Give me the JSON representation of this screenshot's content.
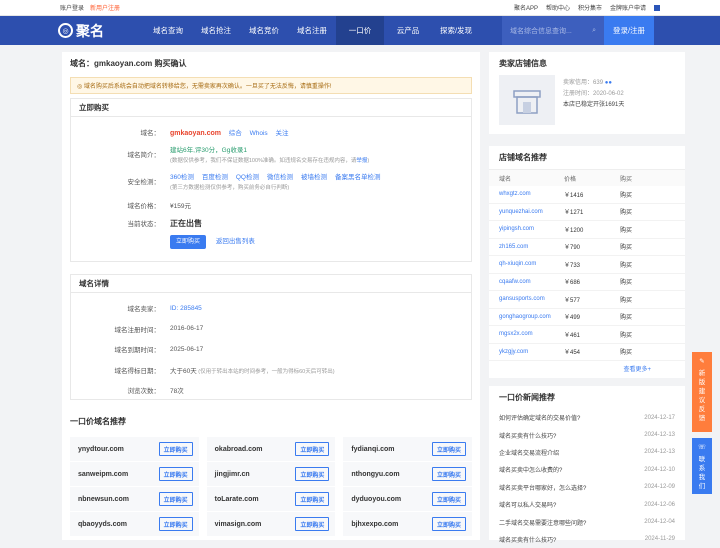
{
  "topbar": {
    "login": "账户登录",
    "register": "新用户注册",
    "app": "聚名APP",
    "help": "帮助中心",
    "points": "积分集市",
    "gold": "金牌账户申请"
  },
  "nav": {
    "logo": "聚名",
    "items": [
      "域名查询",
      "域名抢注",
      "域名竞价",
      "域名注册",
      "一口价",
      "云产品",
      "探索/发现"
    ],
    "active": 4,
    "search_placeholder": "域名综合信息查询...",
    "login": "登录/注册"
  },
  "page": {
    "title": "域名：gmkaoyan.com 购买确认",
    "notice": "◎ 域名购买后系统会自动把域名转移给您，无需卖家再次确认。一旦买了无法反悔，请慎重操作!"
  },
  "buy": {
    "header": "立即购买",
    "domain_label": "域名：",
    "domain": "gmkaoyan.com",
    "links": [
      "综合",
      "Whois",
      "关注"
    ],
    "intro_label": "域名简介：",
    "intro1": "建站6年,评30分，Gg收录1",
    "intro2": "(数据仅供参考，我们不保证数据100%准确。如违规名交易存在违规内容，请",
    "report": "举报",
    "intro3": ")",
    "security_label": "安全检测：",
    "checks": [
      "360检测",
      "百度检测",
      "QQ检测",
      "微信检测",
      "被墙检测",
      "备案黑名单检测"
    ],
    "checks_note": "(第三方数据检测仅供参考，购买前务必自行判断)",
    "price_label": "域名价格：",
    "price": "¥159元",
    "status_label": "当前状态：",
    "status": "正在出售",
    "buy_btn": "立即购买",
    "back": "返回出售列表"
  },
  "detail": {
    "header": "域名详情",
    "rows": [
      {
        "k": "域名卖家：",
        "v": "ID: 285845",
        "blue": true
      },
      {
        "k": "域名注册时间：",
        "v": "2016-06-17"
      },
      {
        "k": "域名到期时间：",
        "v": "2025-06-17"
      },
      {
        "k": "域名得标日期：",
        "v": "大于60天",
        "note": " (仅用于转出本站的时间参考，一般为得标60天后可转出)"
      },
      {
        "k": "浏览次数：",
        "v": "78次"
      }
    ]
  },
  "rec": {
    "title": "一口价域名推荐",
    "btn": "立即购买",
    "items": [
      "ynydtour.com",
      "okabroad.com",
      "fydianqi.com",
      "sanweipm.com",
      "jingjimr.cn",
      "nthongyu.com",
      "nbnewsun.com",
      "toLarate.com",
      "dyduoyou.com",
      "qbaoyyds.com",
      "vimasign.com",
      "bjhxexpo.com"
    ]
  },
  "seller": {
    "title": "卖家店铺信息",
    "credit_label": "卖家信用：",
    "credit": "639",
    "reg_label": "注册时间：",
    "reg": "2020-06-02",
    "open": "本店已稳定开张1691天"
  },
  "store": {
    "title": "店铺域名推荐",
    "cols": [
      "域名",
      "价格",
      "购买"
    ],
    "buy": "购买",
    "rows": [
      [
        "whxgtz.com",
        "￥1416"
      ],
      [
        "yunquezhai.com",
        "￥1271"
      ],
      [
        "yipingsh.com",
        "￥1200"
      ],
      [
        "zh165.com",
        "￥790"
      ],
      [
        "qh-xiuqin.com",
        "￥733"
      ],
      [
        "cqaafw.com",
        "￥686"
      ],
      [
        "gansusports.com",
        "￥577"
      ],
      [
        "gonghaogroup.com",
        "￥499"
      ],
      [
        "mgsx2x.com",
        "￥461"
      ],
      [
        "ykzgjy.com",
        "￥454"
      ]
    ],
    "more": "查看更多+"
  },
  "newsbox": {
    "title": "一口价新闻推荐",
    "items": [
      [
        "如何评估确定域名的交易价值?",
        "2024-12-17"
      ],
      [
        "域名买卖有什么技巧?",
        "2024-12-13"
      ],
      [
        "企业域名交易流程介绍",
        "2024-12-13"
      ],
      [
        "域名买卖中怎么收费的?",
        "2024-12-10"
      ],
      [
        "域名买卖平台哪家好，怎么选择?",
        "2024-12-09"
      ],
      [
        "域名可以私人交易吗?",
        "2024-12-06"
      ],
      [
        "二手域名交易需要注意哪些问题?",
        "2024-12-04"
      ],
      [
        "域名买卖有什么技巧?",
        "2024-11-29"
      ]
    ]
  },
  "float": {
    "f1": "新版建议反馈",
    "f2": "联系我们"
  }
}
